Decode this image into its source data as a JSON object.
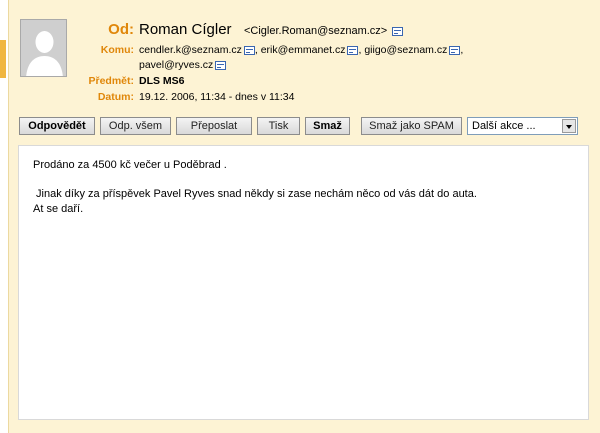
{
  "header": {
    "from_label": "Od:",
    "from_name": "Roman Cígler",
    "from_email": "<Cigler.Roman@seznam.cz>",
    "to_label": "Komu:",
    "recipients_line1": [
      "cendler.k@seznam.cz",
      ", erik@emmanet.cz",
      ", giigo@seznam.cz",
      ","
    ],
    "recipients_line2": "pavel@ryves.cz",
    "subject_label": "Předmět:",
    "subject": "DLS MS6",
    "date_label": "Datum:",
    "date": "19.12. 2006, 11:34 - dnes v 11:34"
  },
  "toolbar": {
    "reply": "Odpovědět",
    "reply_all": "Odp. všem",
    "forward": "Přeposlat",
    "print": "Tisk",
    "delete": "Smaž",
    "spam": "Smaž jako SPAM",
    "more_actions": "Další akce ..."
  },
  "message": {
    "line1": "Prodáno za 4500 kč večer u Poděbrad .",
    "line2": " Jinak díky za příspěvek Pavel Ryves snad někdy si zase nechám něco od vás dát do auta.",
    "line3": "At se daří."
  },
  "colors": {
    "label_orange": "#e0870a",
    "header_bg": "#fdf3d4",
    "accent": "#f0b640"
  },
  "icons": {
    "avatar": "person-silhouette-icon",
    "contact": "contact-card-icon",
    "dropdown": "chevron-down-icon"
  }
}
